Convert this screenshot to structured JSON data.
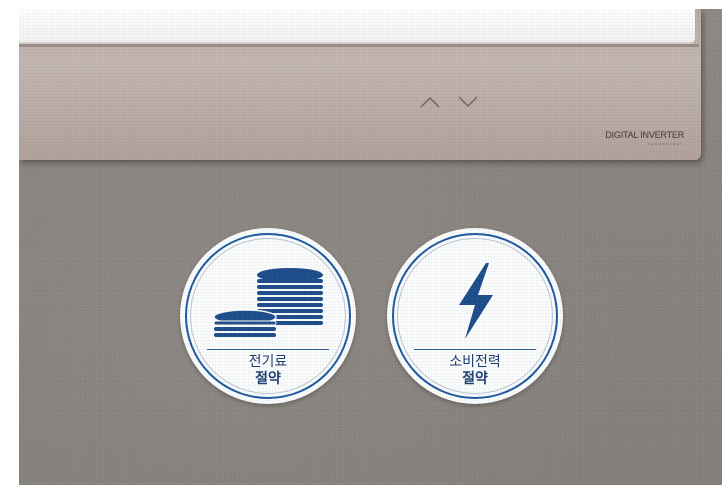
{
  "panel": {
    "brand_text": "DIGITAL INVERTER",
    "brand_subtext": "TECHNOLOGY",
    "icons": [
      "chevron-up-icon",
      "chevron-down-icon"
    ]
  },
  "badges": [
    {
      "icon": "coins-icon",
      "line1": "전기료",
      "line2": "절약"
    },
    {
      "icon": "lightning-icon",
      "line1": "소비전력",
      "line2": "절약"
    }
  ],
  "colors": {
    "badge_blue": "#1e5aa0",
    "text_blue": "#1e3f70",
    "wall": "#8a8580",
    "panel": "#bcaea8"
  }
}
